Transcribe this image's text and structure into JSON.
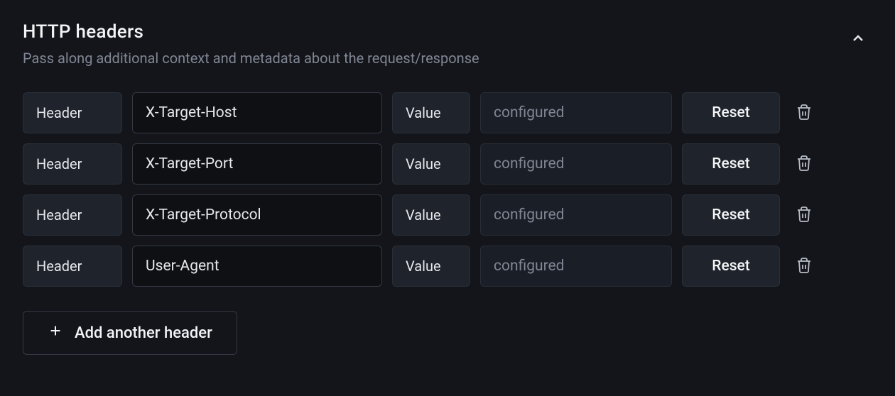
{
  "section": {
    "title": "HTTP headers",
    "description": "Pass along additional context and metadata about the request/response"
  },
  "labels": {
    "header": "Header",
    "value": "Value",
    "reset": "Reset",
    "add": "Add another header"
  },
  "rows": [
    {
      "header": "X-Target-Host",
      "value_placeholder": "configured"
    },
    {
      "header": "X-Target-Port",
      "value_placeholder": "configured"
    },
    {
      "header": "X-Target-Protocol",
      "value_placeholder": "configured"
    },
    {
      "header": "User-Agent",
      "value_placeholder": "configured"
    }
  ]
}
